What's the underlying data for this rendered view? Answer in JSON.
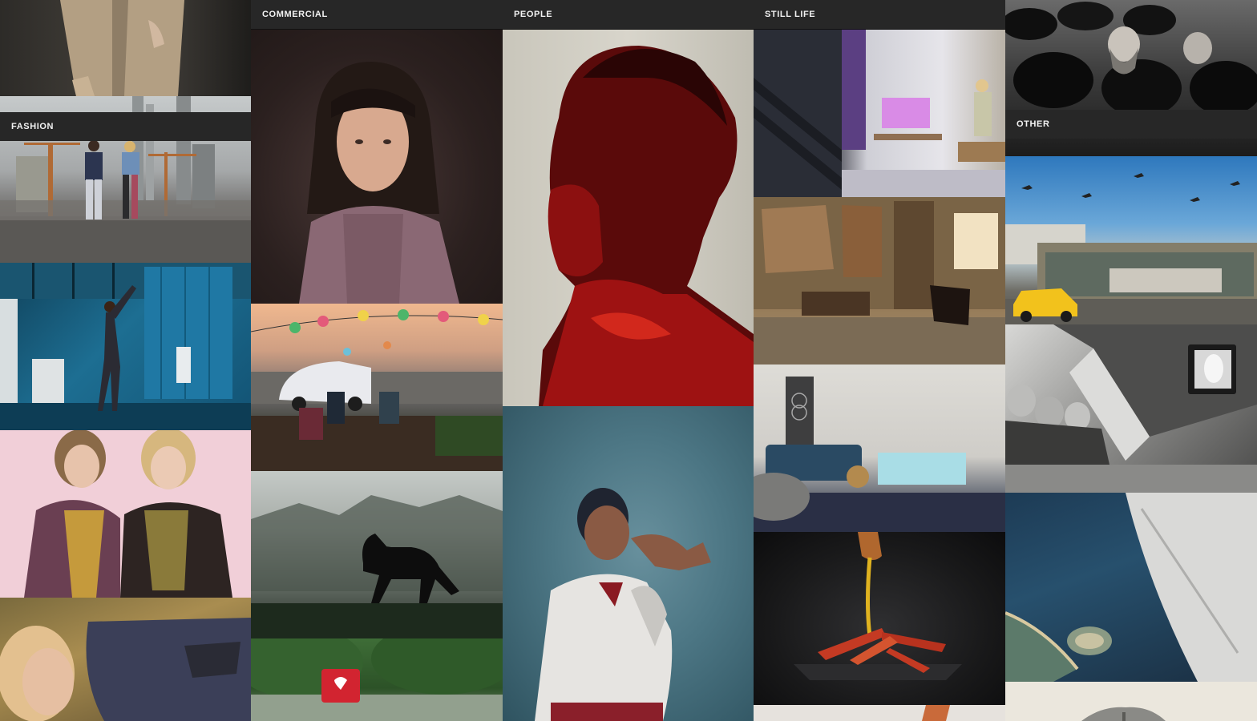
{
  "columns": [
    {
      "id": "fashion",
      "header": "FASHION",
      "tiles": [
        {
          "subject": "model in khaki suit against gray backdrop"
        },
        {
          "subject": "two models walking on rooftop with city skyline"
        },
        {
          "subject": "dancer stretching in blue locker room"
        },
        {
          "subject": "two models in patterned silk jackets on pink background"
        },
        {
          "subject": "model lying in hay wearing dark jacket"
        }
      ]
    },
    {
      "id": "commercial",
      "header": "COMMERCIAL",
      "tiles": [
        {
          "subject": "portrait of girl with dark hair in pink cardigan"
        },
        {
          "subject": "rooftop party with white electric car and paper lanterns"
        },
        {
          "subject": "black horse galloping in misty field"
        },
        {
          "subject": "red defibrillator case mounted in park"
        }
      ]
    },
    {
      "id": "people",
      "header": "PEOPLE",
      "tiles": [
        {
          "subject": "profile portrait of man lit in red light"
        },
        {
          "subject": "performer in ruffled white shirt with expressive hand pose"
        }
      ]
    },
    {
      "id": "still-life",
      "header": "STILL LIFE",
      "tiles": [
        {
          "subject": "living room with purple light and woman reading"
        },
        {
          "subject": "historic room with frescoes and leather chair"
        },
        {
          "subject": "modern interior with blue sofa and speaker"
        },
        {
          "subject": "king crab legs with sauce being poured"
        },
        {
          "subject": "orange object on light background"
        }
      ]
    },
    {
      "id": "other",
      "header": "OTHER",
      "tiles": [
        {
          "subject": "crowd of men wearing black hats"
        },
        {
          "subject": "yellow taxi by graffiti wall under blue sky with planes"
        },
        {
          "subject": "black and white children watching screen"
        },
        {
          "subject": "aerial view from airplane window over coastline"
        },
        {
          "subject": "tree silhouette on beige background"
        }
      ]
    }
  ],
  "colors": {
    "header_bg": "#272727",
    "header_text": "#f2f2f2",
    "page_bg": "#111111"
  }
}
